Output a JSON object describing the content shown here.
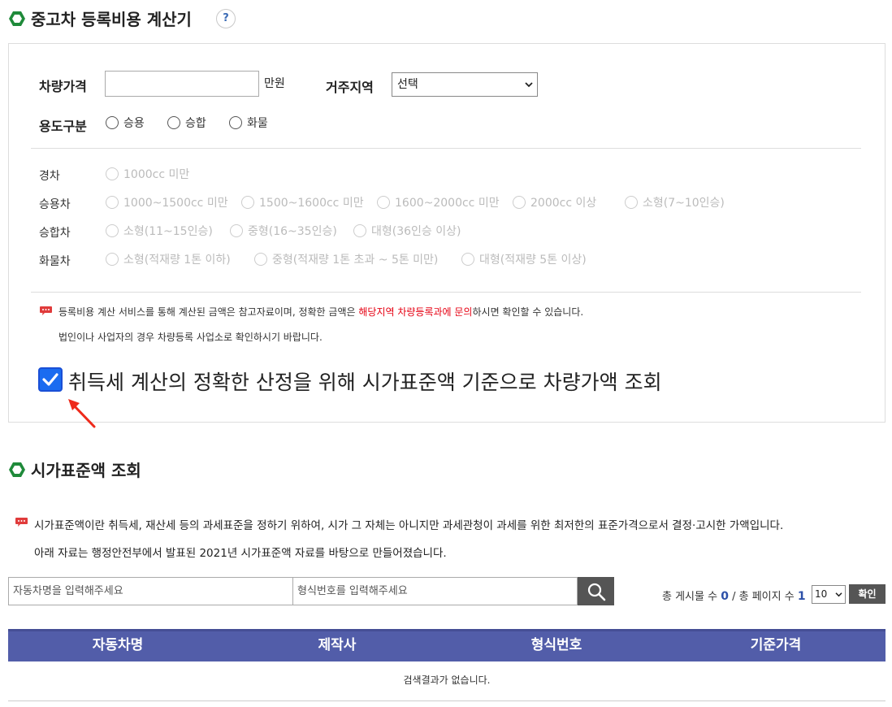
{
  "calc": {
    "title": "중고차 등록비용 계산기",
    "help_label": "?",
    "price_label": "차량가격",
    "price_value": "",
    "price_unit": "만원",
    "region_label": "거주지역",
    "region_selected": "선택",
    "usage_label": "용도구분",
    "usage_options": [
      "승용",
      "승합",
      "화물"
    ],
    "categories": [
      {
        "label": "경차",
        "options": [
          "1000cc 미만"
        ]
      },
      {
        "label": "승용차",
        "options": [
          "1000~1500cc 미만",
          "1500~1600cc 미만",
          "1600~2000cc 미만",
          "2000cc 이상",
          "소형(7~10인승)"
        ]
      },
      {
        "label": "승합차",
        "options": [
          "소형(11~15인승)",
          "중형(16~35인승)",
          "대형(36인승 이상)"
        ]
      },
      {
        "label": "화물차",
        "options": [
          "소형(적재량 1톤 이하)",
          "중형(적재량 1톤 초과 ~ 5톤 미만)",
          "대형(적재량 5톤 이상)"
        ]
      }
    ],
    "notice_1_pre": "등록비용 계산 서비스를 통해 계산된 금액은 참고자료이며, 정확한 금액은 ",
    "notice_1_red": "해당지역 차량등록과에 문의",
    "notice_1_post": "하시면 확인할 수 있습니다.",
    "notice_2": "법인이나 사업자의 경우 차량등록 사업소로 확인하시기 바랍니다.",
    "checkbox_label": "취득세 계산의 정확한 산정을 위해 시가표준액 기준으로 차량가액 조회",
    "checkbox_checked": true
  },
  "lookup": {
    "title": "시가표준액 조회",
    "desc_1": "시가표준액이란 취득세, 재산세 등의 과세표준을 정하기 위하여, 시가 그 자체는 아니지만 과세관청이 과세를 위한 최저한의 표준가격으로서 결정·고시한 가액입니다.",
    "desc_2": "아래 자료는 행정안전부에서 발표된 2021년 시가표준액 자료를 바탕으로 만들어졌습니다.",
    "car_name_placeholder": "자동차명을 입력해주세요",
    "model_no_placeholder": "형식번호를 입력해주세요",
    "total_posts_label": "총 게시물 수",
    "total_posts": "0",
    "total_pages_label": "총 페이지 수",
    "total_pages": "1",
    "per_page": "10",
    "confirm_label": "확인",
    "columns": [
      "자동차명",
      "제작사",
      "형식번호",
      "기준가격"
    ],
    "empty_message": "검색결과가 없습니다."
  },
  "colors": {
    "hex_icon": "#1f8a3a",
    "table_header": "#525da9",
    "accent_blue": "#2d50a8",
    "notice_red": "#e60012"
  }
}
